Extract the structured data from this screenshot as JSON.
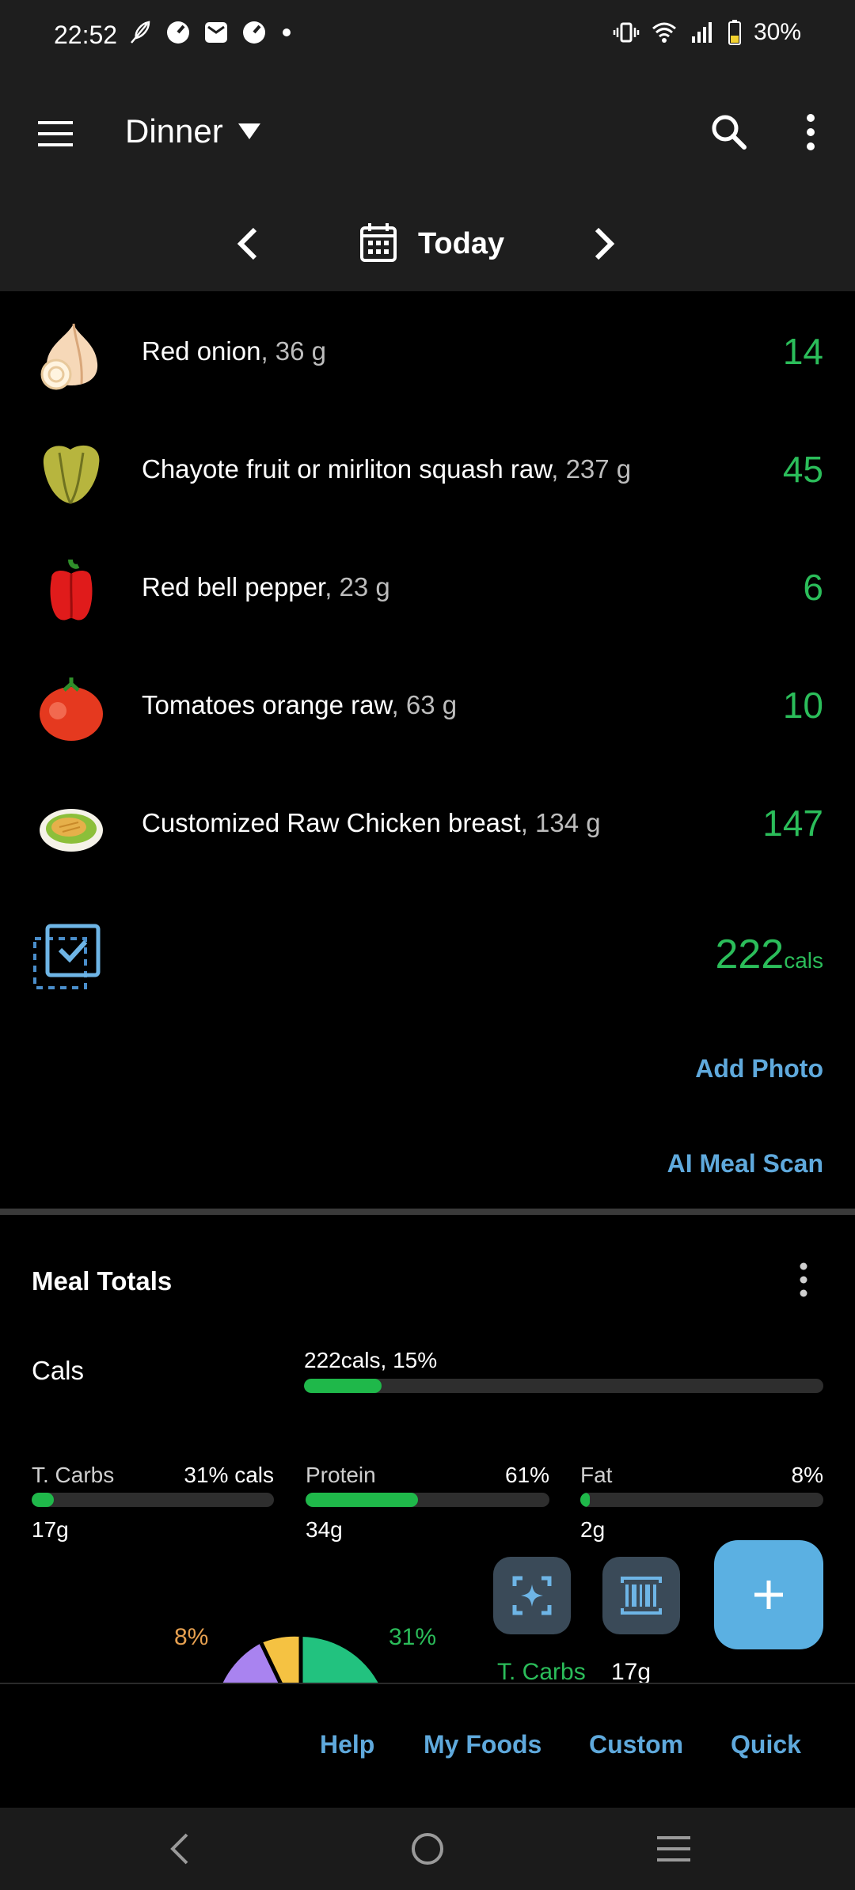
{
  "status_bar": {
    "time": "22:52",
    "battery": "30%",
    "left_icons": [
      "feather-icon",
      "speedometer-icon",
      "mail-icon",
      "speedometer-icon",
      "dot-icon"
    ],
    "right_icons": [
      "vibrate-icon",
      "wifi-icon",
      "signal-icon",
      "battery-icon"
    ]
  },
  "app_bar": {
    "meal_selector": "Dinner",
    "date_label": "Today"
  },
  "food_items": [
    {
      "name": "Red onion",
      "qty": ", 36 g",
      "cals": "14",
      "icon": "onion-icon"
    },
    {
      "name": "Chayote fruit or mirliton squash raw",
      "qty": ", 237 g",
      "cals": "45",
      "icon": "chayote-icon"
    },
    {
      "name": "Red bell pepper",
      "qty": ", 23 g",
      "cals": "6",
      "icon": "bell-pepper-icon"
    },
    {
      "name": "Tomatoes orange raw",
      "qty": ", 63 g",
      "cals": "10",
      "icon": "tomato-icon"
    },
    {
      "name": "Customized Raw Chicken breast",
      "qty": ", 134 g",
      "cals": "147",
      "icon": "chicken-breast-icon"
    }
  ],
  "total": {
    "value": "222",
    "unit": "cals"
  },
  "actions": {
    "add_photo": "Add Photo",
    "ai_meal_scan": "AI Meal Scan"
  },
  "meal_totals": {
    "title": "Meal Totals",
    "cals_label": "Cals",
    "cals_value": "222cals, 15%",
    "cals_progress": 0.15,
    "macros": [
      {
        "label": "T. Carbs",
        "pct": "31% cals",
        "value": "17g",
        "progress": 0.09
      },
      {
        "label": "Protein",
        "pct": "61%",
        "value": "34g",
        "progress": 0.46
      },
      {
        "label": "Fat",
        "pct": "8%",
        "value": "2g",
        "progress": 0.04
      }
    ],
    "pie": {
      "label_left": "8%",
      "label_right": "31%",
      "colors": {
        "carbs": "#22c27f",
        "fat": "#f5c242",
        "protein": "#a983f0"
      }
    },
    "legend_preview": {
      "label": "T. Carbs",
      "value": "17g"
    }
  },
  "bottom_tabs": [
    "Help",
    "My Foods",
    "Custom",
    "Quick"
  ],
  "colors": {
    "accent_green": "#2bbd5a",
    "accent_blue": "#5fa9dc",
    "fab_blue": "#5bb0e2"
  }
}
